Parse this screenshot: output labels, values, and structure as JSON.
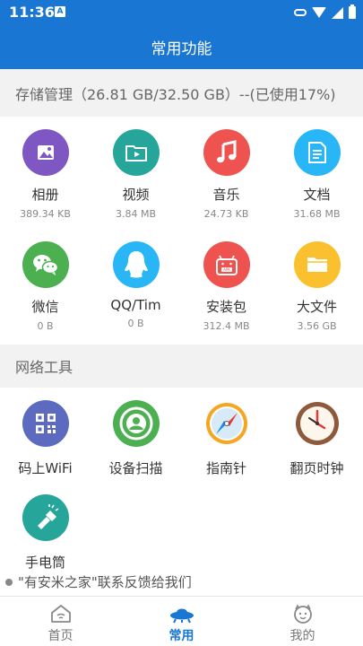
{
  "status_bar": {
    "time": "11:36",
    "notification_icon": "A"
  },
  "header": {
    "title": "常用功能"
  },
  "storage": {
    "heading": "存储管理（26.81 GB/32.50 GB）--(已使用17%)",
    "items": [
      {
        "label": "相册",
        "size": "389.34 KB",
        "icon": "photo-icon",
        "color": "#7e57c2"
      },
      {
        "label": "视频",
        "size": "3.84 MB",
        "icon": "video-folder-icon",
        "color": "#26a69a"
      },
      {
        "label": "音乐",
        "size": "24.73 KB",
        "icon": "music-note-icon",
        "color": "#ef5350"
      },
      {
        "label": "文档",
        "size": "31.68 MB",
        "icon": "document-icon",
        "color": "#29b6f6"
      },
      {
        "label": "微信",
        "size": "0 B",
        "icon": "wechat-icon",
        "color": "#4caf50"
      },
      {
        "label": "QQ/Tim",
        "size": "0 B",
        "icon": "qq-icon",
        "color": "#29b6f6"
      },
      {
        "label": "安装包",
        "size": "312.4 MB",
        "icon": "apk-icon",
        "color": "#ef5350"
      },
      {
        "label": "大文件",
        "size": "3.56 GB",
        "icon": "folder-icon",
        "color": "#fbc02d"
      }
    ]
  },
  "network": {
    "heading": "网络工具",
    "items": [
      {
        "label": "码上WiFi",
        "icon": "qr-code-icon"
      },
      {
        "label": "设备扫描",
        "icon": "device-scan-icon"
      },
      {
        "label": "指南针",
        "icon": "compass-icon"
      },
      {
        "label": "翻页时钟",
        "icon": "clock-icon"
      },
      {
        "label": "手电筒",
        "icon": "flashlight-icon"
      }
    ]
  },
  "notice": "\"有安米之家\"联系反馈给我们",
  "bottom_nav": [
    {
      "label": "首页",
      "icon": "home-icon",
      "active": false
    },
    {
      "label": "常用",
      "icon": "ufo-icon",
      "active": true
    },
    {
      "label": "我的",
      "icon": "face-icon",
      "active": false
    }
  ],
  "colors": {
    "primary": "#1976d2",
    "section_bg": "#f2f2f2"
  }
}
